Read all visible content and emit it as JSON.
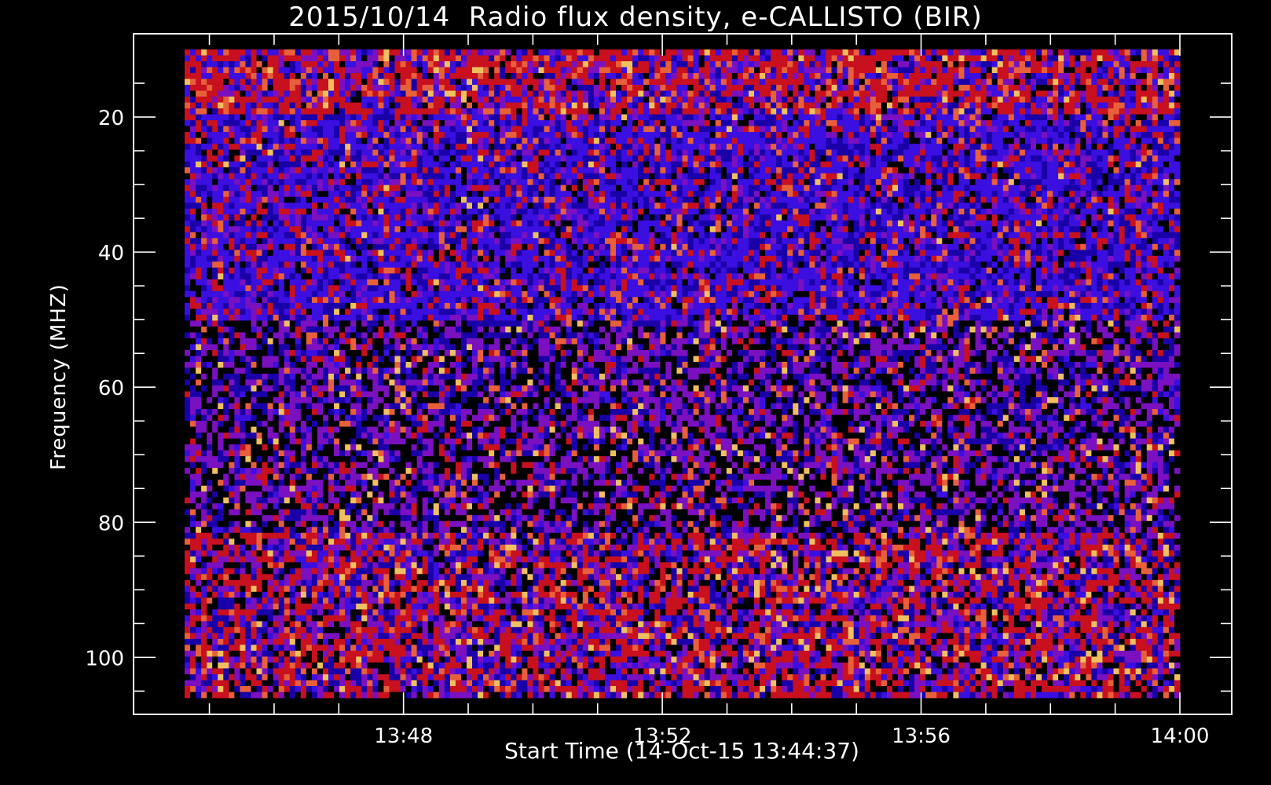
{
  "chart_data": {
    "type": "heatmap",
    "title": "2015/10/14  Radio flux density, e-CALLISTO (BIR)",
    "xlabel": "Start Time (14-Oct-15 13:44:37)",
    "ylabel": "Frequency (MHZ)",
    "x_ticks": [
      "13:48",
      "13:52",
      "13:56",
      "14:00"
    ],
    "x_range": [
      "13:44:37",
      "14:00:00"
    ],
    "y_ticks": [
      20,
      40,
      60,
      80,
      100
    ],
    "y_range": [
      10,
      106
    ],
    "y_inverted": true,
    "colormap": [
      "#000000",
      "#1a00a8",
      "#3a0fe0",
      "#7a10c0",
      "#c8101e",
      "#e8603a",
      "#f0c060"
    ],
    "intensity_bands": [
      {
        "freq_range": [
          10,
          20
        ],
        "level": "high",
        "dominant": "red-blue"
      },
      {
        "freq_range": [
          20,
          50
        ],
        "level": "high",
        "dominant": "blue"
      },
      {
        "freq_range": [
          50,
          80
        ],
        "level": "low",
        "dominant": "purple-black"
      },
      {
        "freq_range": [
          80,
          106
        ],
        "level": "medium",
        "dominant": "red-purple"
      }
    ]
  }
}
